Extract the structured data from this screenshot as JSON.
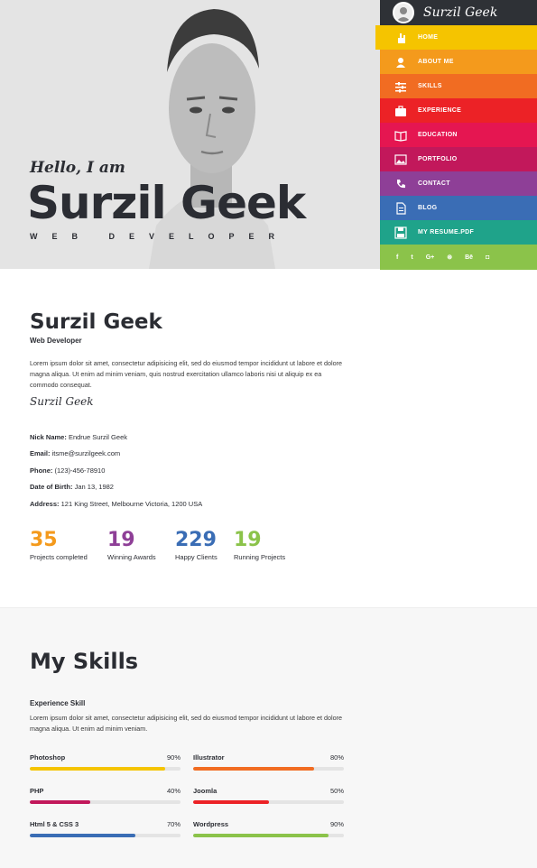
{
  "hero": {
    "greeting": "Hello, I am",
    "name": "Surzil Geek",
    "role": "WEB DEVELOPER"
  },
  "brand": {
    "name": "Surzil Geek"
  },
  "nav": [
    {
      "label": "HOME",
      "icon": "hand-icon",
      "color": "#f5c400"
    },
    {
      "label": "ABOUT ME",
      "icon": "user-icon",
      "color": "#f49a1c"
    },
    {
      "label": "SKILLS",
      "icon": "sliders-icon",
      "color": "#f16c22"
    },
    {
      "label": "EXPERIENCE",
      "icon": "briefcase-icon",
      "color": "#ec2226"
    },
    {
      "label": "EDUCATION",
      "icon": "book-icon",
      "color": "#e51651"
    },
    {
      "label": "PORTFOLIO",
      "icon": "image-icon",
      "color": "#c2185b"
    },
    {
      "label": "CONTACT",
      "icon": "phone-icon",
      "color": "#8e3f97"
    },
    {
      "label": "BLOG",
      "icon": "document-icon",
      "color": "#3a6db5"
    },
    {
      "label": "MY RESUME.PDF",
      "icon": "save-icon",
      "color": "#1fa38a"
    }
  ],
  "social": [
    {
      "label": "f",
      "icon": "facebook-icon"
    },
    {
      "label": "t",
      "icon": "twitter-icon"
    },
    {
      "label": "G+",
      "icon": "google-plus-icon"
    },
    {
      "label": "⊛",
      "icon": "dribbble-icon"
    },
    {
      "label": "Bē",
      "icon": "behance-icon"
    },
    {
      "label": "◘",
      "icon": "github-icon"
    }
  ],
  "about": {
    "name": "Surzil Geek",
    "role": "Web Developer",
    "text": "Lorem ipsum dolor sit amet, consectetur adipisicing elit, sed do eiusmod tempor incididunt ut labore et dolore magna aliqua. Ut enim ad minim veniam, quis nostrud exercitation ullamco laboris nisi ut aliquip ex ea commodo consequat.",
    "signature": "Surzil Geek",
    "info": [
      {
        "key": "Nick Name:",
        "value": "Endrue Surzil Geek"
      },
      {
        "key": "Email:",
        "value": "itsme@surzilgeek.com"
      },
      {
        "key": "Phone:",
        "value": "(123)-456-78910"
      },
      {
        "key": "Date of Birth:",
        "value": "Jan 13, 1982"
      },
      {
        "key": "Address:",
        "value": "121 King Street, Melbourne Victoria, 1200 USA"
      }
    ]
  },
  "stats": [
    {
      "value": "35",
      "label": "Projects completed",
      "color": "#f49a1c"
    },
    {
      "value": "19",
      "label": "Winning Awards",
      "color": "#8e3f97"
    },
    {
      "value": "229",
      "label": "Happy Clients",
      "color": "#3a6db5"
    },
    {
      "value": "19",
      "label": "Running Projects",
      "color": "#8bc34a"
    }
  ],
  "skills": {
    "title": "My Skills",
    "subtitle": "Experience Skill",
    "text": "Lorem ipsum dolor sit amet, consectetur adipisicing elit, sed do eiusmod tempor incididunt ut labore et dolore magna aliqua. Ut enim ad minim veniam.",
    "items": [
      {
        "name": "Photoshop",
        "pct_label": "90%",
        "pct": 90,
        "color": "#f5c400"
      },
      {
        "name": "Illustrator",
        "pct_label": "80%",
        "pct": 80,
        "color": "#f16c22"
      },
      {
        "name": "PHP",
        "pct_label": "40%",
        "pct": 40,
        "color": "#c2185b"
      },
      {
        "name": "Joomla",
        "pct_label": "50%",
        "pct": 50,
        "color": "#ec2226"
      },
      {
        "name": "Html 5 & CSS 3",
        "pct_label": "70%",
        "pct": 70,
        "color": "#3a6db5"
      },
      {
        "name": "Wordpress",
        "pct_label": "90%",
        "pct": 90,
        "color": "#8bc34a"
      }
    ]
  }
}
